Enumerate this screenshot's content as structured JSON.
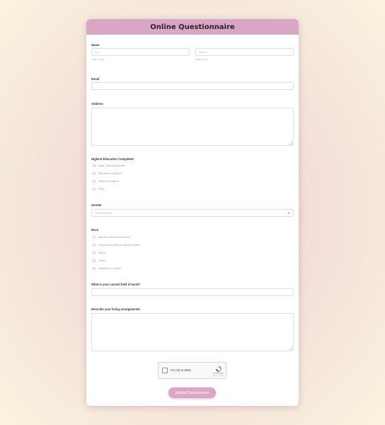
{
  "form": {
    "title": "Online Questionnaire",
    "name": {
      "label": "Name",
      "first_placeholder": "Lyd",
      "last_placeholder": "Mighty",
      "first_sublabel": "First name",
      "last_sublabel": "Last name"
    },
    "email": {
      "label": "Email",
      "value": ""
    },
    "address": {
      "label": "Address",
      "value": ""
    },
    "education": {
      "label": "Highest Education Completed",
      "options": [
        "High School Diploma",
        "Bachelor's Degree",
        "Master's Degree",
        "PhD"
      ]
    },
    "gender": {
      "label": "Gender",
      "placeholder": "Select Option"
    },
    "race": {
      "label": "Race",
      "options": [
        "Black or African American",
        "American Indian or Alaska Native",
        "Asian",
        "White",
        "Hispanic or Latino"
      ]
    },
    "work": {
      "label": "What is your current field of work?",
      "value": ""
    },
    "living": {
      "label": "Describe your living arrangements",
      "value": ""
    },
    "captcha": {
      "label": "I'm not a robot",
      "brand": "reCAPTCHA",
      "terms": "Privacy - Terms"
    },
    "submit_label": "Submit Questionnaire"
  },
  "colors": {
    "header": "#d9a6c6",
    "submit": "#dba7c4"
  }
}
